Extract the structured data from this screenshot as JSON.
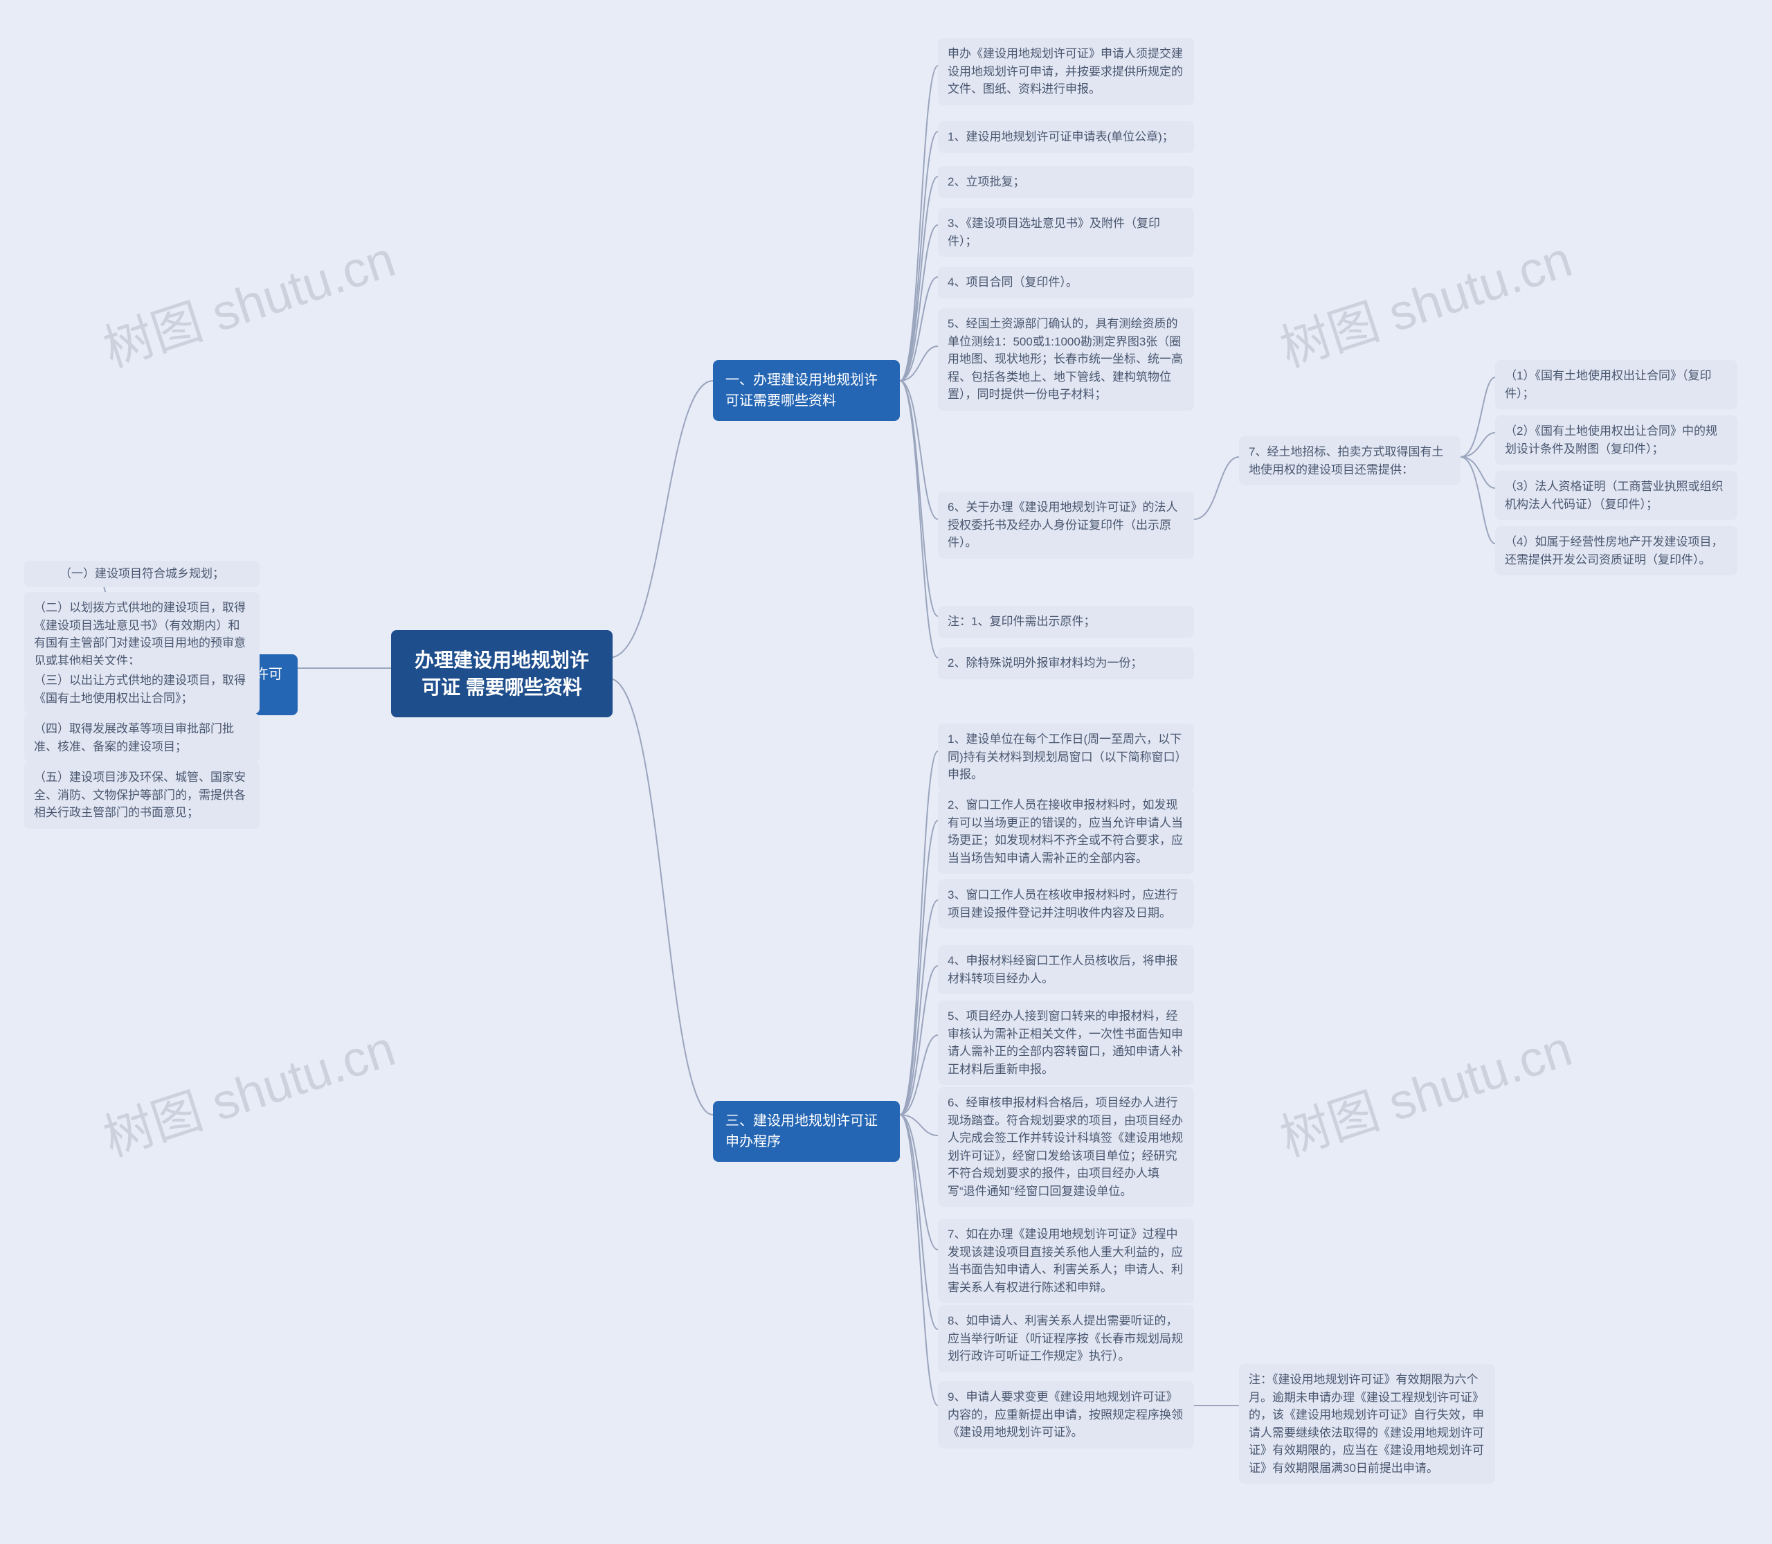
{
  "watermark": "树图 shutu.cn",
  "root": {
    "title": "办理建设用地规划许可证\n需要哪些资料"
  },
  "section1": {
    "title": "一、办理建设用地规划许可证需要哪些资料",
    "intro": "申办《建设用地规划许可证》申请人须提交建设用地规划许可申请，并按要求提供所规定的文件、图纸、资料进行申报。",
    "items": [
      "1、建设用地规划许可证申请表(单位公章)；",
      "2、立项批复；",
      "3、《建设项目选址意见书》及附件（复印件）；",
      "4、项目合同（复印件）。",
      "5、经国土资源部门确认的，具有测绘资质的单位测绘1：500或1:1000勘测定界图3张（圈用地图、现状地形；长春市统一坐标、统一高程、包括各类地上、地下管线、建构筑物位置），同时提供一份电子材料；",
      "6、关于办理《建设用地规划许可证》的法人授权委托书及经办人身份证复印件（出示原件）。"
    ],
    "item7": {
      "text": "7、经土地招标、拍卖方式取得国有土地使用权的建设项目还需提供：",
      "subs": [
        "（1）《国有土地使用权出让合同》（复印件）；",
        "（2）《国有土地使用权出让合同》中的规划设计条件及附图（复印件）；",
        "（3）法人资格证明（工商营业执照或组织机构法人代码证）（复印件）；",
        "（4）如属于经营性房地产开发建设项目，还需提供开发公司资质证明（复印件）。"
      ]
    },
    "notes": [
      "注：1、复印件需出示原件；",
      "2、除特殊说明外报审材料均为一份；"
    ]
  },
  "section2": {
    "title": "二、建设用地规划许可证许可条件",
    "items": [
      "（一）建设项目符合城乡规划；",
      "（二）以划拨方式供地的建设项目，取得《建设项目选址意见书》（有效期内）和有国有主管部门对建设项目用地的预审意见或其他相关文件；",
      "（三）以出让方式供地的建设项目，取得《国有土地使用权出让合同》；",
      "（四）取得发展改革等项目审批部门批准、核准、备案的建设项目；",
      "（五）建设项目涉及环保、城管、国家安全、消防、文物保护等部门的，需提供各相关行政主管部门的书面意见；"
    ]
  },
  "section3": {
    "title": "三、建设用地规划许可证申办程序",
    "items": [
      "1、建设单位在每个工作日(周一至周六，以下同)持有关材料到规划局窗口（以下简称窗口）申报。",
      "2、窗口工作人员在接收申报材料时，如发现有可以当场更正的错误的，应当允许申请人当场更正；如发现材料不齐全或不符合要求，应当当场告知申请人需补正的全部内容。",
      "3、窗口工作人员在核收申报材料时，应进行项目建设报件登记并注明收件内容及日期。",
      "4、申报材料经窗口工作人员核收后，将申报材料转项目经办人。",
      "5、项目经办人接到窗口转来的申报材料，经审核认为需补正相关文件，一次性书面告知申请人需补正的全部内容转窗口，通知申请人补正材料后重新申报。",
      "6、经审核申报材料合格后，项目经办人进行现场踏查。符合规划要求的项目，由项目经办人完成会签工作并转设计科填签《建设用地规划许可证》，经窗口发给该项目单位；经研究不符合规划要求的报件，由项目经办人填写“退件通知”经窗口回复建设单位。",
      "7、如在办理《建设用地规划许可证》过程中发现该建设项目直接关系他人重大利益的，应当书面告知申请人、利害关系人；申请人、利害关系人有权进行陈述和申辩。",
      "8、如申请人、利害关系人提出需要听证的，应当举行听证（听证程序按《长春市规划局规划行政许可听证工作规定》执行）。",
      "9、申请人要求变更《建设用地规划许可证》内容的，应重新提出申请，按照规定程序换领《建设用地规划许可证》。"
    ],
    "note9": "注：《建设用地规划许可证》有效期限为六个月。逾期未申请办理《建设工程规划许可证》的，该《建设用地规划许可证》自行失效，申请人需要继续依法取得的《建设用地规划许可证》有效期限的，应当在《建设用地规划许可证》有效期限届满30日前提出申请。"
  }
}
